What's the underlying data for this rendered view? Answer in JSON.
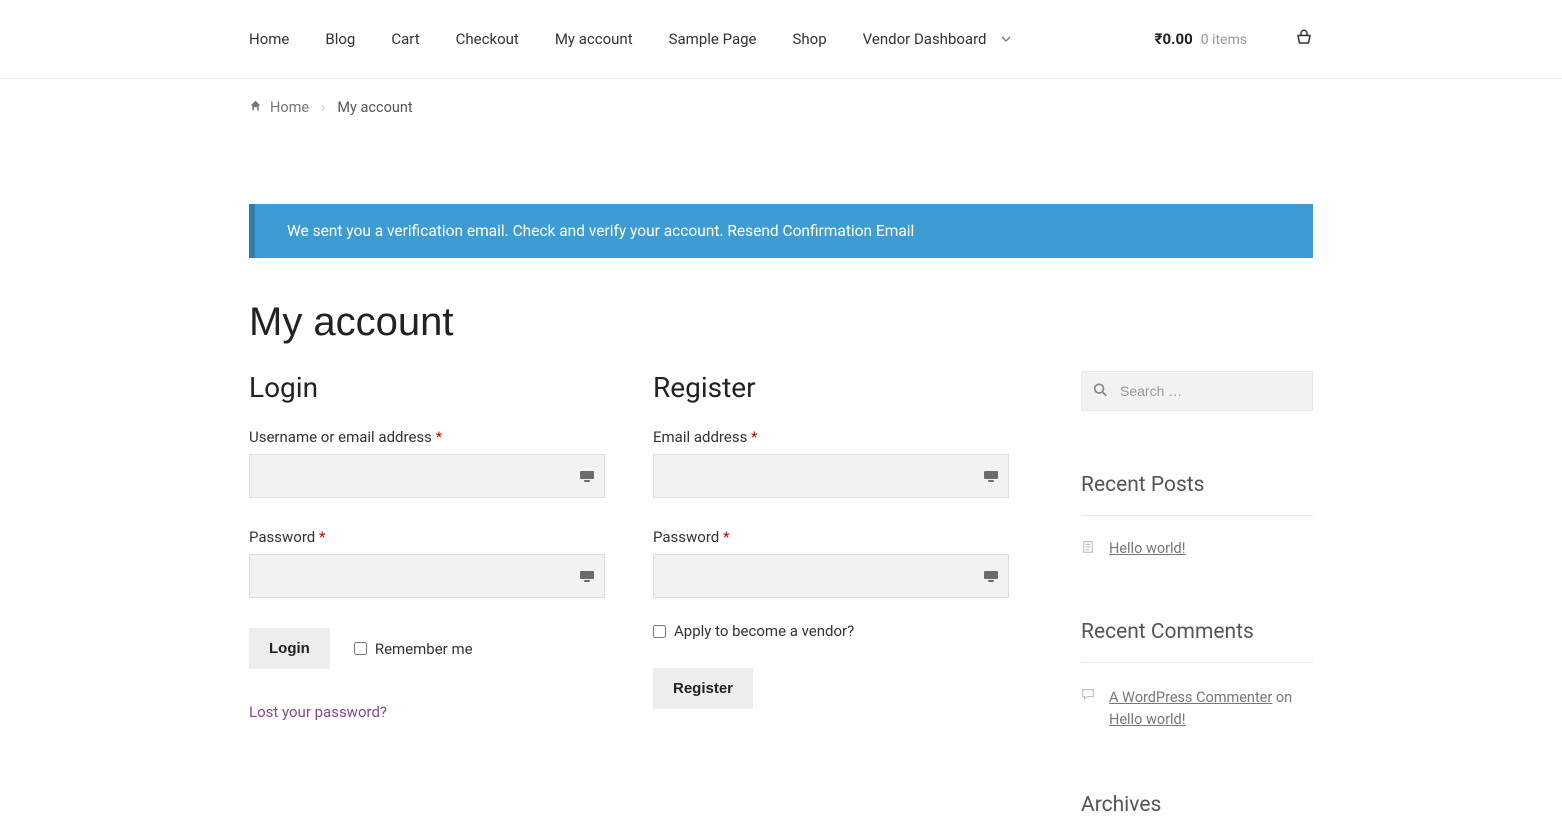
{
  "nav": {
    "items": [
      "Home",
      "Blog",
      "Cart",
      "Checkout",
      "My account",
      "Sample Page",
      "Shop",
      "Vendor Dashboard"
    ]
  },
  "cart": {
    "price": "₹0.00",
    "items": "0 items"
  },
  "breadcrumb": {
    "home": "Home",
    "current": "My account"
  },
  "notice": {
    "text": "We sent you a verification email. Check and verify your account. ",
    "link": "Resend Confirmation Email"
  },
  "page_title": "My account",
  "login": {
    "heading": "Login",
    "username_label": "Username or email address ",
    "password_label": "Password ",
    "button": "Login",
    "remember": "Remember me",
    "lost": "Lost your password?"
  },
  "register": {
    "heading": "Register",
    "email_label": "Email address ",
    "password_label": "Password ",
    "vendor": "Apply to become a vendor?",
    "button": "Register"
  },
  "sidebar": {
    "search_placeholder": "Search …",
    "recent_posts_title": "Recent Posts",
    "recent_posts": [
      "Hello world!"
    ],
    "recent_comments_title": "Recent Comments",
    "recent_comments": [
      {
        "author": "A WordPress Commenter",
        "on": " on ",
        "post": "Hello world!"
      }
    ],
    "archives_title": "Archives"
  },
  "required_marker": "*"
}
